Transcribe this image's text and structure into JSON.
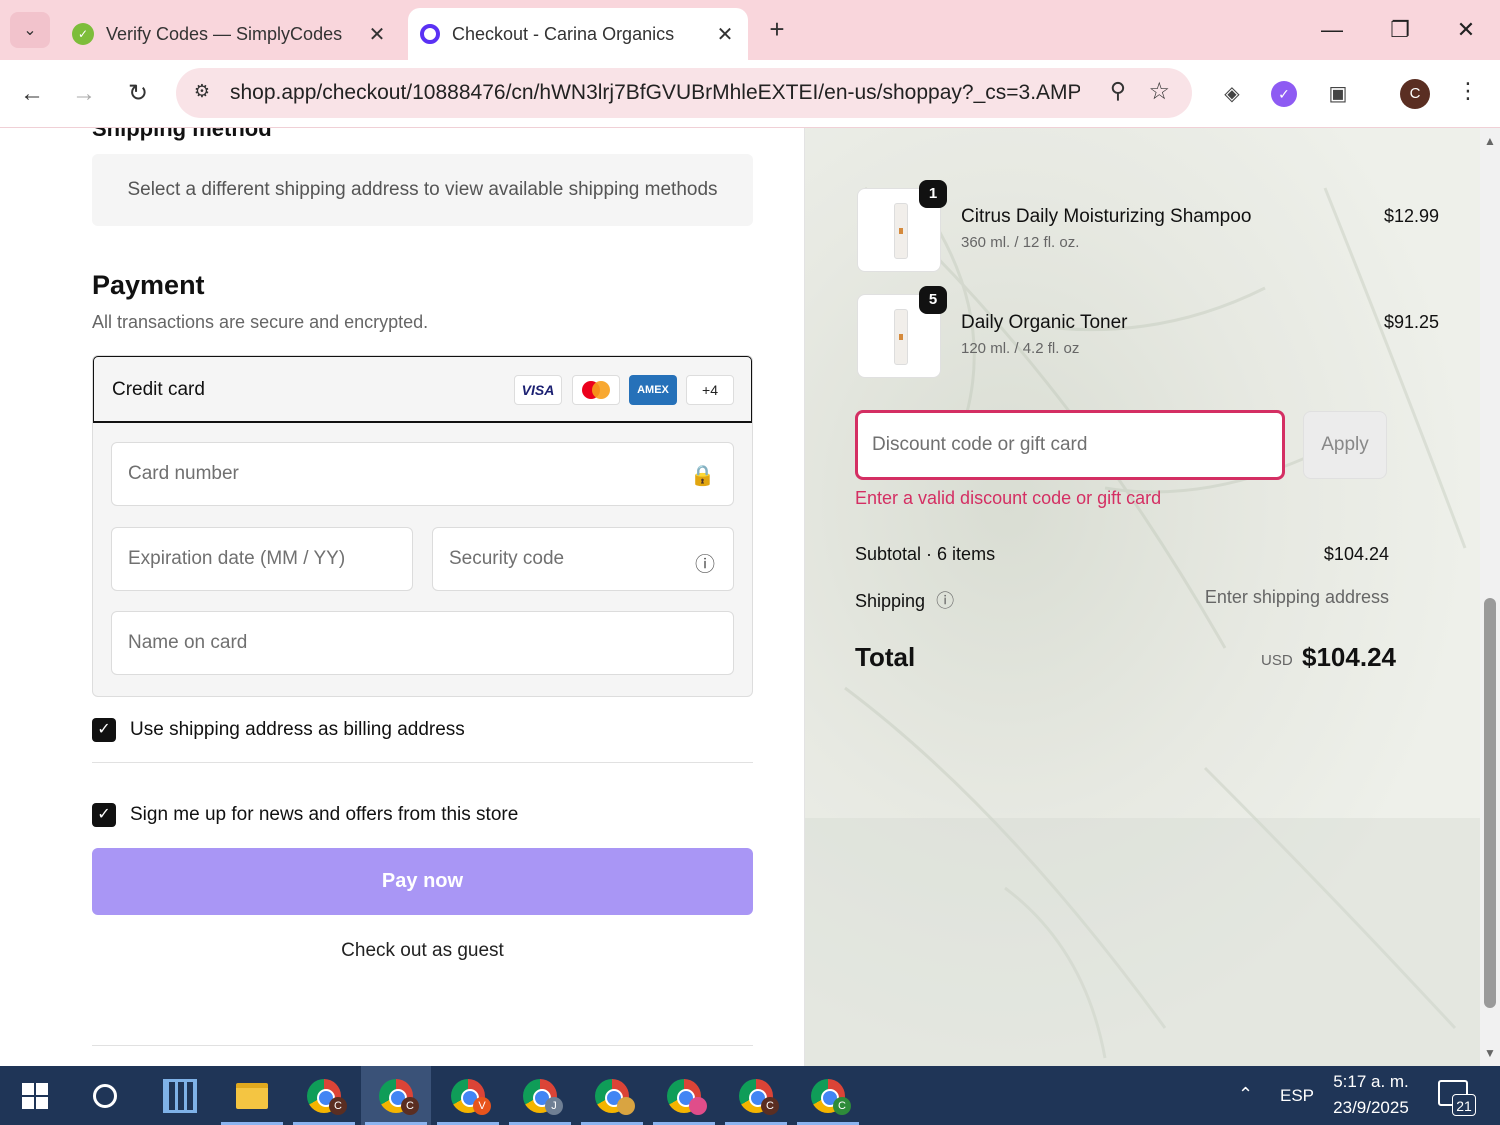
{
  "browser": {
    "tabs": [
      {
        "title": "Verify Codes — SimplyCodes",
        "active": false
      },
      {
        "title": "Checkout - Carina Organics",
        "active": true
      }
    ],
    "url": "shop.app/checkout/10888476/cn/hWN3lrj7BfGVUBrMhleEXTEI/en-us/shoppay?_cs=3.AMPS...",
    "profile_initial": "C"
  },
  "checkout": {
    "shipping_method_heading": "Shipping method",
    "shipping_note": "Select a different shipping address to view available shipping methods",
    "payment": {
      "title": "Payment",
      "subtitle": "All transactions are secure and encrypted.",
      "method_label": "Credit card",
      "brands": {
        "visa": "VISA",
        "amex": "AMEX",
        "more": "+4"
      },
      "fields": {
        "card_number": "Card number",
        "expiration": "Expiration date (MM / YY)",
        "security_code": "Security code",
        "name_on_card": "Name on card"
      }
    },
    "billing_checkbox": "Use shipping address as billing address",
    "newsletter_checkbox": "Sign me up for news and offers from this store",
    "pay_button": "Pay now",
    "guest_link": "Check out as guest"
  },
  "summary": {
    "items": [
      {
        "qty": "1",
        "name": "Citrus Daily Moisturizing Shampoo",
        "variant": "360 ml. / 12 fl. oz.",
        "price": "$12.99"
      },
      {
        "qty": "5",
        "name": "Daily Organic Toner",
        "variant": "120 ml. / 4.2 fl. oz",
        "price": "$91.25"
      }
    ],
    "discount_placeholder": "Discount code or gift card",
    "apply_label": "Apply",
    "discount_error": "Enter a valid discount code or gift card",
    "subtotal_label": "Subtotal · 6 items",
    "subtotal_value": "$104.24",
    "shipping_label": "Shipping",
    "shipping_value": "Enter shipping address",
    "total_label": "Total",
    "total_currency": "USD",
    "total_value": "$104.24"
  },
  "taskbar": {
    "language": "ESP",
    "time": "5:17 a. m.",
    "date": "23/9/2025",
    "notification_count": "21",
    "chrome_badges": [
      "C",
      "C",
      "V",
      "J",
      "",
      "",
      "C",
      "C"
    ]
  },
  "colors": {
    "tabbar": "#f9d6dc",
    "pay_button": "#a996f5",
    "error": "#d42f63",
    "taskbar": "#1f3557"
  }
}
